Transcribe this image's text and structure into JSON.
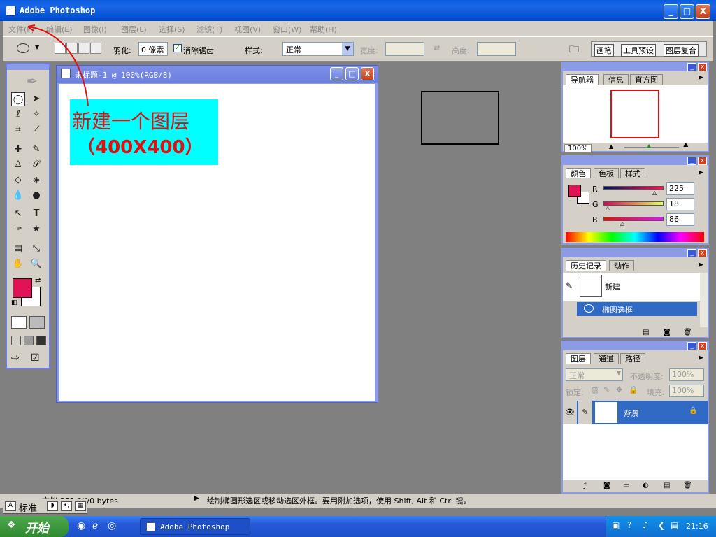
{
  "window": {
    "title": "Adobe Photoshop",
    "min": "_",
    "max": "□",
    "close": "X"
  },
  "menu": [
    "文件(F)",
    "编辑(E)",
    "图像(I)",
    "图层(L)",
    "选择(S)",
    "滤镜(T)",
    "视图(V)",
    "窗口(W)",
    "帮助(H)"
  ],
  "options": {
    "feather_label": "羽化:",
    "feather_value": "0 像素",
    "antialias_label": "消除锯齿",
    "style_label": "样式:",
    "style_value": "正常",
    "width_label": "宽度:",
    "height_label": "高度:",
    "palette_tabs": [
      "画笔",
      "工具预设",
      "图层复合"
    ]
  },
  "document": {
    "title": "未标题-1 @ 100%(RGB/8)",
    "annotation_line1": "新建一个图层",
    "annotation_line2": "（400X400）",
    "annotation_bg": "#00ffff",
    "annotation_color": "#e01010"
  },
  "navigator": {
    "tabs": [
      "导航器",
      "信息",
      "直方图"
    ],
    "zoom": "100%"
  },
  "color": {
    "tabs": [
      "颜色",
      "色板",
      "样式"
    ],
    "r_label": "R",
    "g_label": "G",
    "b_label": "B",
    "r": "225",
    "g": "18",
    "b": "86",
    "foreground": "#e11256",
    "background": "#ffffff"
  },
  "history": {
    "tabs": [
      "历史记录",
      "动作"
    ],
    "items": [
      "新建",
      "椭圆选框"
    ]
  },
  "layers": {
    "tabs": [
      "图层",
      "通道",
      "路径"
    ],
    "blend": "正常",
    "opacity_label": "不透明度:",
    "opacity": "100%",
    "lock_label": "锁定:",
    "fill_label": "填充:",
    "fill": "100%",
    "layer_name": "背景"
  },
  "status": {
    "doc_info": "文档:352.0K/0 bytes",
    "hint": "绘制椭圆形选区或移动选区外框。要用附加选项，使用 Shift, Alt 和 Ctrl 键。"
  },
  "ime": {
    "label": "标准"
  },
  "taskbar": {
    "start": "开始",
    "task": "Adobe Photoshop",
    "clock": "21:16"
  }
}
